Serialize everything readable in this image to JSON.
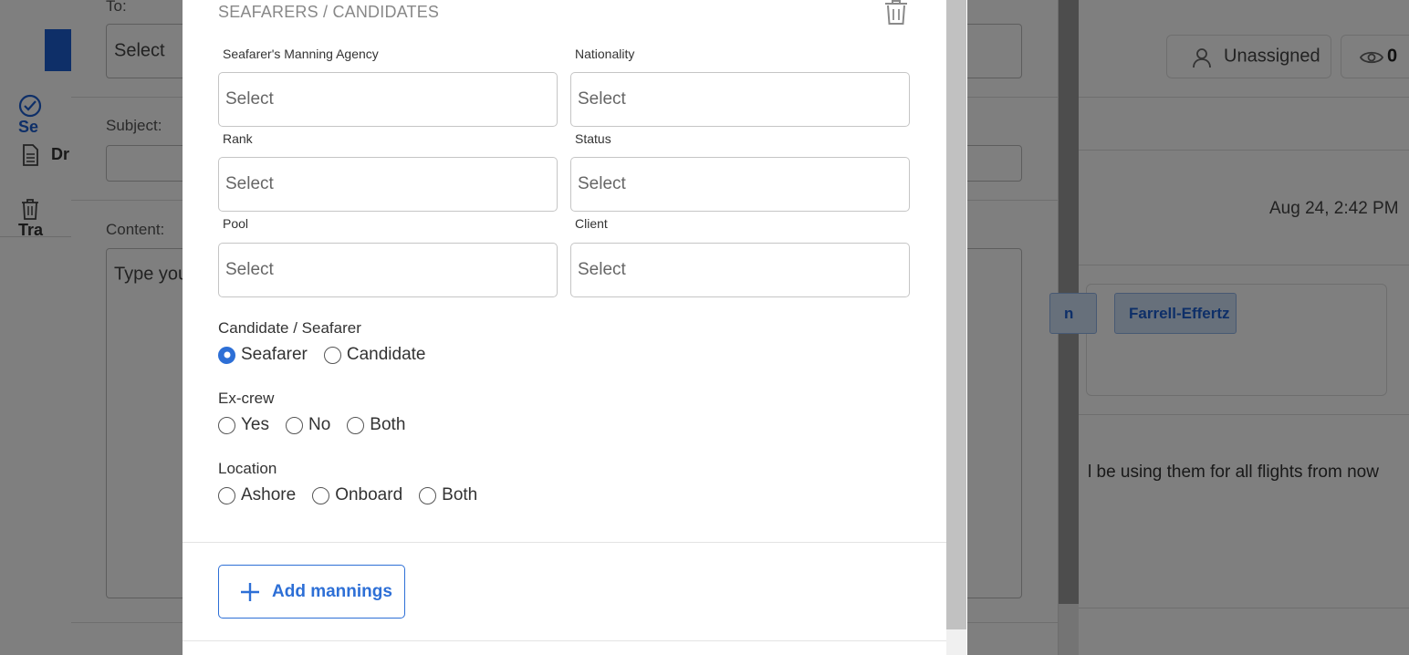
{
  "background": {
    "nav_items": [
      {
        "label": "Se",
        "icon": "check-circle-icon"
      },
      {
        "label": "Dr",
        "icon": "document-icon"
      },
      {
        "label": "Tra",
        "icon": "trash-icon"
      }
    ],
    "to_label": "To:",
    "to_value": "Select",
    "subject_label": "Subject:",
    "content_label": "Content:",
    "content_placeholder": "Type you",
    "assignee": "Unassigned",
    "watchers_count": "0",
    "date": "Aug 24, 2:42 PM",
    "tags": [
      "n",
      "Farrell-Effertz"
    ],
    "body_text": "l be using them for all flights from now"
  },
  "modal": {
    "section_title": "SEAFARERS / CANDIDATES",
    "fields": {
      "manning_agency": {
        "label": "Seafarer's Manning Agency",
        "value": "Select"
      },
      "nationality": {
        "label": "Nationality",
        "value": "Select"
      },
      "rank": {
        "label": "Rank",
        "value": "Select"
      },
      "status": {
        "label": "Status",
        "value": "Select"
      },
      "pool": {
        "label": "Pool",
        "value": "Select"
      },
      "client": {
        "label": "Client",
        "value": "Select"
      }
    },
    "candidate_group": {
      "label": "Candidate / Seafarer",
      "options": [
        "Seafarer",
        "Candidate"
      ],
      "selected": "Seafarer"
    },
    "excrew_group": {
      "label": "Ex-crew",
      "options": [
        "Yes",
        "No",
        "Both"
      ],
      "selected": ""
    },
    "location_group": {
      "label": "Location",
      "options": [
        "Ashore",
        "Onboard",
        "Both"
      ],
      "selected": ""
    },
    "add_button_label": "Add mannings"
  },
  "colors": {
    "accent": "#2d6fd6",
    "overlay": "rgba(0,0,0,0.5)"
  }
}
